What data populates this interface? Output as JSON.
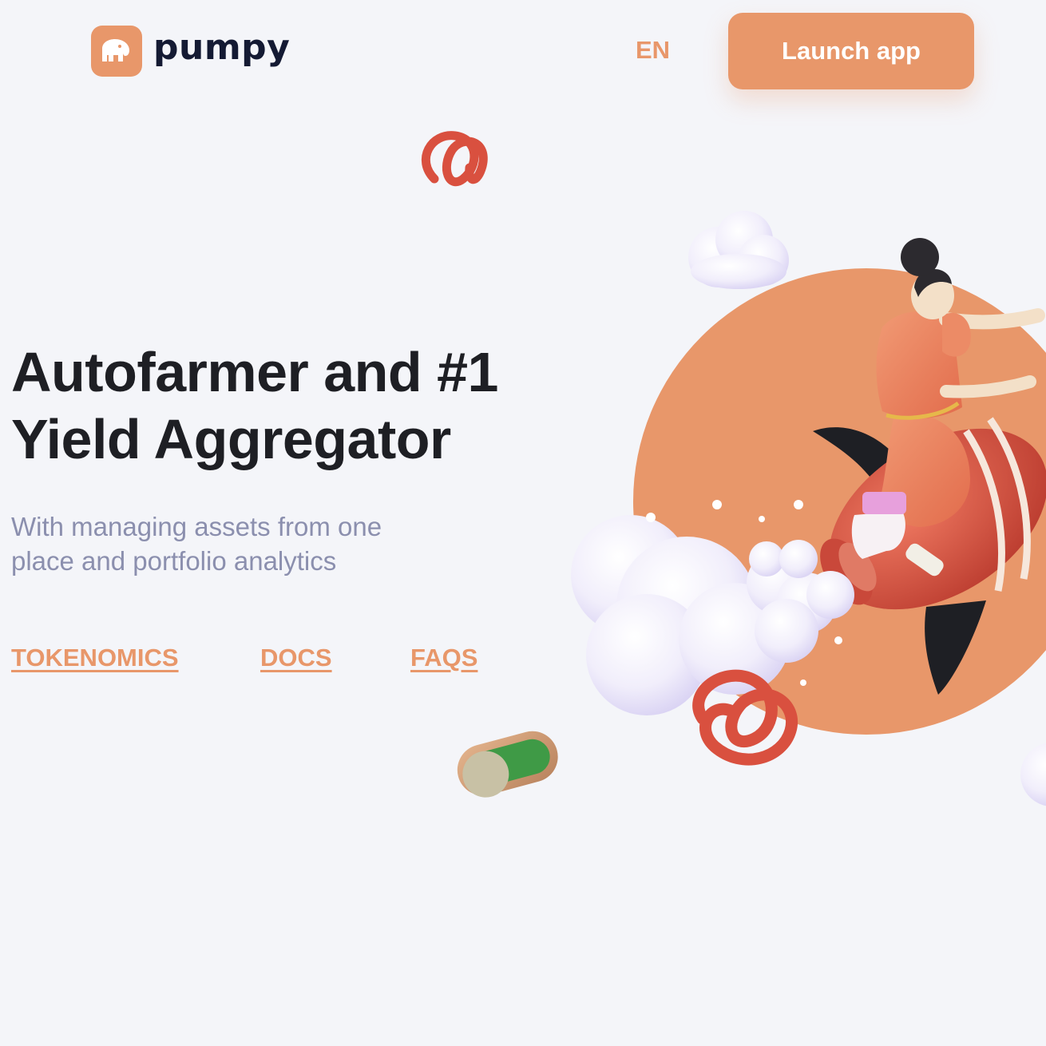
{
  "header": {
    "logo_text": "pumpy",
    "language": "EN",
    "launch_button": "Launch app"
  },
  "hero": {
    "title_line1": "Autofarmer and #1",
    "title_line2": "Yield Aggregator",
    "subtitle_line1": "With managing assets from one",
    "subtitle_line2": "place and portfolio analytics"
  },
  "links": {
    "tokenomics": "TOKENOMICS",
    "docs": "DOCS",
    "faqs": "FAQS"
  },
  "colors": {
    "accent": "#e8976a",
    "background": "#f4f5f9",
    "heading": "#1e1f24",
    "muted": "#8b8fae",
    "logo_text": "#141a33",
    "rocket_red": "#d9503f",
    "toggle_green": "#3f9a46"
  }
}
